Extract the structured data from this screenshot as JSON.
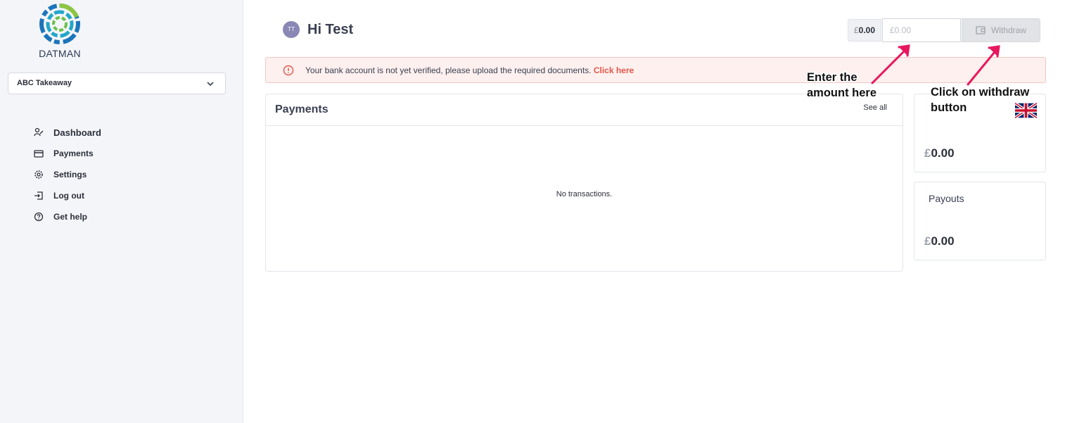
{
  "sidebar": {
    "logo_text": "DATMAN",
    "store_name": "ABC Takeaway",
    "items": [
      {
        "label": "Dashboard",
        "icon": "dashboard-icon"
      },
      {
        "label": "Payments",
        "icon": "card-icon"
      },
      {
        "label": "Settings",
        "icon": "gear-icon"
      },
      {
        "label": "Log out",
        "icon": "logout-icon"
      },
      {
        "label": "Get help",
        "icon": "help-icon"
      }
    ]
  },
  "header": {
    "avatar_initials": "TT",
    "greeting": "Hi Test",
    "balance_currency": "£",
    "balance_amount": "0.00",
    "amount_placeholder": "£0.00",
    "withdraw_label": "Withdraw"
  },
  "alert": {
    "message": "Your bank account is not yet verified, please upload the required documents.",
    "link_text": "Click here"
  },
  "payments": {
    "title": "Payments",
    "see_all": "See all",
    "empty_text": "No transactions."
  },
  "balance_card": {
    "currency": "£",
    "amount": "0.00"
  },
  "payouts_card": {
    "title": "Payouts",
    "currency": "£",
    "amount": "0.00"
  },
  "annotations": {
    "amount_line1": "Enter the",
    "amount_line2": "amount here",
    "withdraw_line1": "Click on withdraw",
    "withdraw_line2": "button",
    "arrow_color": "#e8175d"
  }
}
